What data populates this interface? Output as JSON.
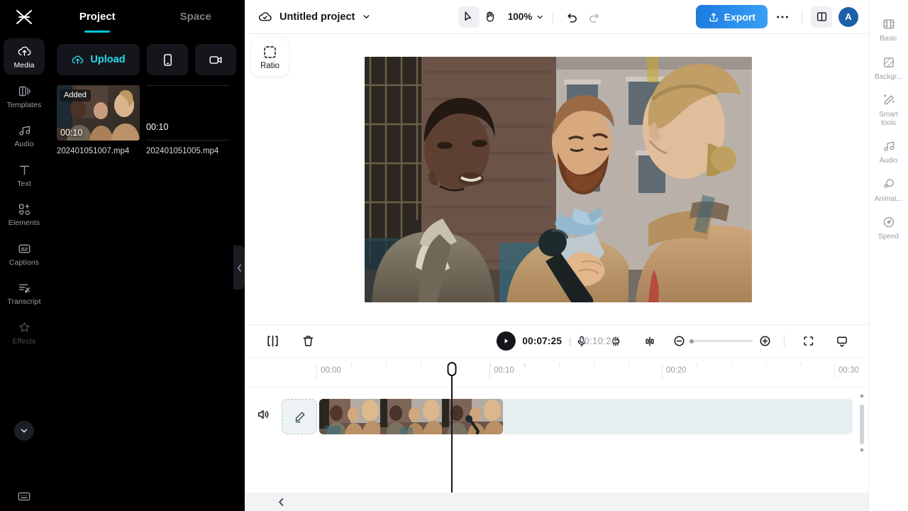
{
  "app": {
    "name": "capcut-web-editor"
  },
  "left_panel": {
    "logo_icon": "capcut-logo-icon",
    "tabs": [
      {
        "label": "Project",
        "active": true
      },
      {
        "label": "Space",
        "active": false
      }
    ],
    "rail_items": [
      {
        "label": "Media",
        "icon": "cloud-upload-icon",
        "active": true
      },
      {
        "label": "Templates",
        "icon": "templates-icon",
        "active": false
      },
      {
        "label": "Audio",
        "icon": "music-note-icon",
        "active": false
      },
      {
        "label": "Text",
        "icon": "text-t-icon",
        "active": false
      },
      {
        "label": "Elements",
        "icon": "elements-shapes-icon",
        "active": false
      },
      {
        "label": "Captions",
        "icon": "captions-icon",
        "active": false
      },
      {
        "label": "Transcript",
        "icon": "transcript-icon",
        "active": false
      },
      {
        "label": "Effects",
        "icon": "sparkle-star-icon",
        "active": false
      }
    ],
    "rail_expand_icon": "chevron-down-icon",
    "rail_bottom_icon": "keyboard-shortcuts-icon",
    "actions": {
      "upload_label": "Upload",
      "upload_icon": "cloud-upload-icon",
      "phone_icon": "phone-import-icon",
      "record_icon": "camera-record-icon"
    },
    "media_items": [
      {
        "name": "202401051007.mp4",
        "duration": "00:10",
        "status": "Added",
        "has_preview": true
      },
      {
        "name": "202401051005.mp4",
        "duration": "00:10",
        "status": "",
        "has_preview": false
      }
    ],
    "collapse_icon": "chevron-left-icon"
  },
  "topbar": {
    "cloud_icon": "cloud-saved-icon",
    "project_title": "Untitled project",
    "project_caret_icon": "chevron-down-icon",
    "select_tool_icon": "cursor-arrow-icon",
    "hand_tool_icon": "hand-pan-icon",
    "zoom_level": "100%",
    "zoom_caret_icon": "chevron-down-icon",
    "undo_icon": "undo-arrow-icon",
    "redo_icon": "redo-arrow-icon",
    "export_label": "Export",
    "export_icon": "export-upload-icon",
    "more_icon": "more-horizontal-icon",
    "panel_toggle_icon": "split-panel-icon",
    "avatar_initial": "A"
  },
  "player": {
    "ratio_label": "Ratio",
    "ratio_icon": "crop-ratio-icon"
  },
  "timeline_toolbar": {
    "split_icon": "split-clip-icon",
    "delete_icon": "trash-delete-icon",
    "play_icon": "play-triangle-icon",
    "current_time": "00:07:25",
    "time_separator": "|",
    "total_time": "00:10:24",
    "mic_icon": "microphone-record-icon",
    "mix_icon": "audio-mix-icon",
    "keyframe_icon": "split-marker-icon",
    "zoom_out_icon": "zoom-out-minus-icon",
    "zoom_in_icon": "zoom-in-plus-icon",
    "fit_icon": "fit-to-screen-icon",
    "monitor_icon": "preview-monitor-icon"
  },
  "timeline": {
    "ruler_labels": [
      "00:00",
      "00:10",
      "00:20",
      "00:30"
    ],
    "audio_track_icon": "speaker-volume-icon",
    "cover_icon": "edit-pencil-icon",
    "playhead_position": "00:07:25",
    "scroll_left_icon": "chevron-left-icon",
    "clip_frame_count": 3
  },
  "right_rail": {
    "items": [
      {
        "label": "Basic",
        "icon": "filmstrip-basic-icon"
      },
      {
        "label": "Backgr...",
        "icon": "background-fill-icon"
      },
      {
        "label": "Smart tools",
        "icon": "magic-wand-icon"
      },
      {
        "label": "Audio",
        "icon": "music-note-icon"
      },
      {
        "label": "Animat...",
        "icon": "animation-circles-icon"
      },
      {
        "label": "Speed",
        "icon": "speedometer-icon"
      }
    ]
  },
  "colors": {
    "accent_cyan": "#25d8e8",
    "export_blue": "#2f92ed",
    "dark_bg": "#000000",
    "panel_dark": "#14161c",
    "track_band": "#e8eff2",
    "avatar_blue": "#1a5fa8"
  }
}
